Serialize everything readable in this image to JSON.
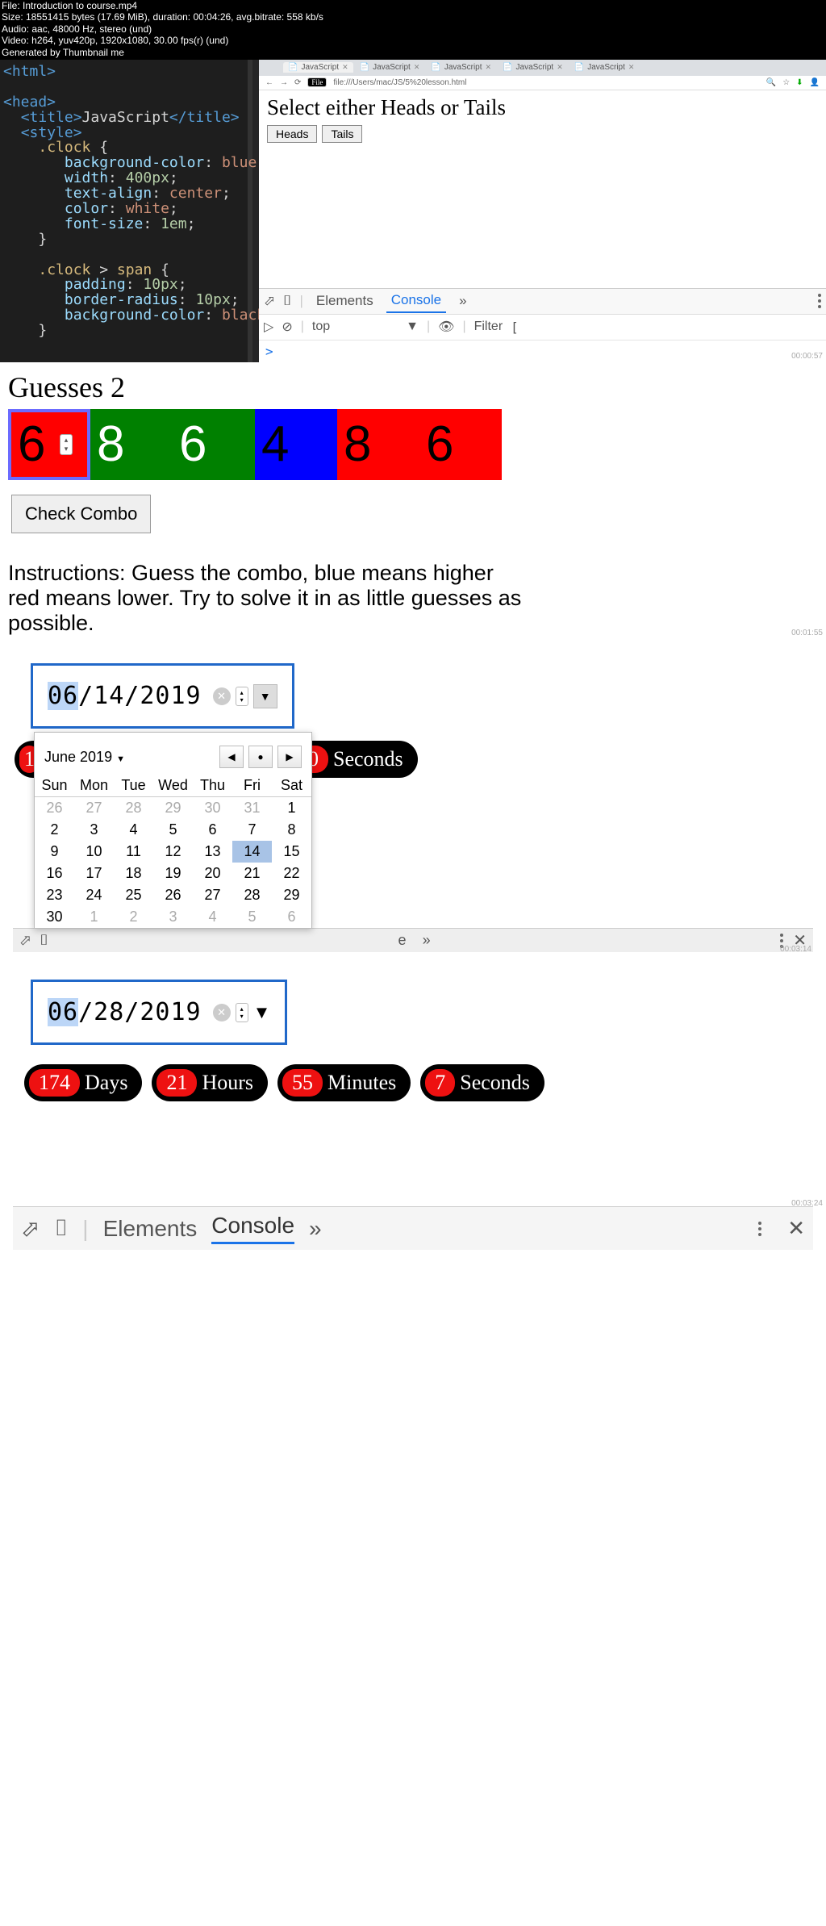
{
  "meta": {
    "file": "File: Introduction to course.mp4",
    "size": "Size: 18551415 bytes (17.69 MiB), duration: 00:04:26, avg.bitrate: 558 kb/s",
    "audio": "Audio: aac, 48000 Hz, stereo (und)",
    "video": "Video: h264, yuv420p, 1920x1080, 30.00 fps(r) (und)",
    "gen": "Generated by Thumbnail me"
  },
  "editor_code": "<html>\n\n<head>\n  <title>JavaScript</title>\n  <style>\n    .clock {\n       background-color: blue;\n       width: 400px;\n       text-align: center;\n       color: white;\n       font-size: 1em;\n    }\n\n    .clock > span {\n       padding: 10px;\n       border-radius: 10px;\n       background-color: black;\n    }",
  "browser": {
    "tabs": [
      "JavaScript",
      "JavaScript",
      "JavaScript",
      "JavaScript",
      "JavaScript"
    ],
    "url": "file:///Users/mac/JS/5%20lesson.html",
    "file_badge": "File",
    "heading": "Select either Heads or Tails",
    "btn1": "Heads",
    "btn2": "Tails",
    "dt": {
      "elements": "Elements",
      "console": "Console",
      "more": "»",
      "top": "top",
      "filter": "Filter",
      "prompt": ">"
    }
  },
  "ts1": "00:00:57",
  "guesses": {
    "title": "Guesses 2",
    "cells": [
      {
        "v": "6",
        "c": "red",
        "first": true
      },
      {
        "v": "8",
        "c": "green"
      },
      {
        "v": "6",
        "c": "green"
      },
      {
        "v": "4",
        "c": "blue"
      },
      {
        "v": "8",
        "c": "red"
      },
      {
        "v": "6",
        "c": "red"
      }
    ],
    "check": "Check Combo",
    "instr": "Instructions: Guess the combo, blue means higher red means lower. Try to solve it in as little guesses as possible."
  },
  "ts2": "00:01:55",
  "date1": {
    "value_hl": "06",
    "value_rest": "/14/2019",
    "month": "June 2019",
    "dow": [
      "Sun",
      "Mon",
      "Tue",
      "Wed",
      "Thu",
      "Fri",
      "Sat"
    ],
    "weeks": [
      [
        "26",
        "27",
        "28",
        "29",
        "30",
        "31",
        "1"
      ],
      [
        "2",
        "3",
        "4",
        "5",
        "6",
        "7",
        "8"
      ],
      [
        "9",
        "10",
        "11",
        "12",
        "13",
        "14",
        "15"
      ],
      [
        "16",
        "17",
        "18",
        "19",
        "20",
        "21",
        "22"
      ],
      [
        "23",
        "24",
        "25",
        "26",
        "27",
        "28",
        "29"
      ],
      [
        "30",
        "1",
        "2",
        "3",
        "4",
        "5",
        "6"
      ]
    ],
    "sel_row": 2,
    "sel_col": 5,
    "secpill_num": "30",
    "secpill_lbl": "Seconds"
  },
  "dt_mini": {
    "more": "»",
    "e": "e"
  },
  "ts3": "00:03:14",
  "date2": {
    "value_hl": "06",
    "value_rest": "/28/2019",
    "pills": [
      {
        "n": "174",
        "l": "Days"
      },
      {
        "n": "21",
        "l": "Hours"
      },
      {
        "n": "55",
        "l": "Minutes"
      },
      {
        "n": "7",
        "l": "Seconds"
      }
    ]
  },
  "dt_big": {
    "elements": "Elements",
    "console": "Console",
    "more": "»"
  },
  "ts4": "00:03:24"
}
